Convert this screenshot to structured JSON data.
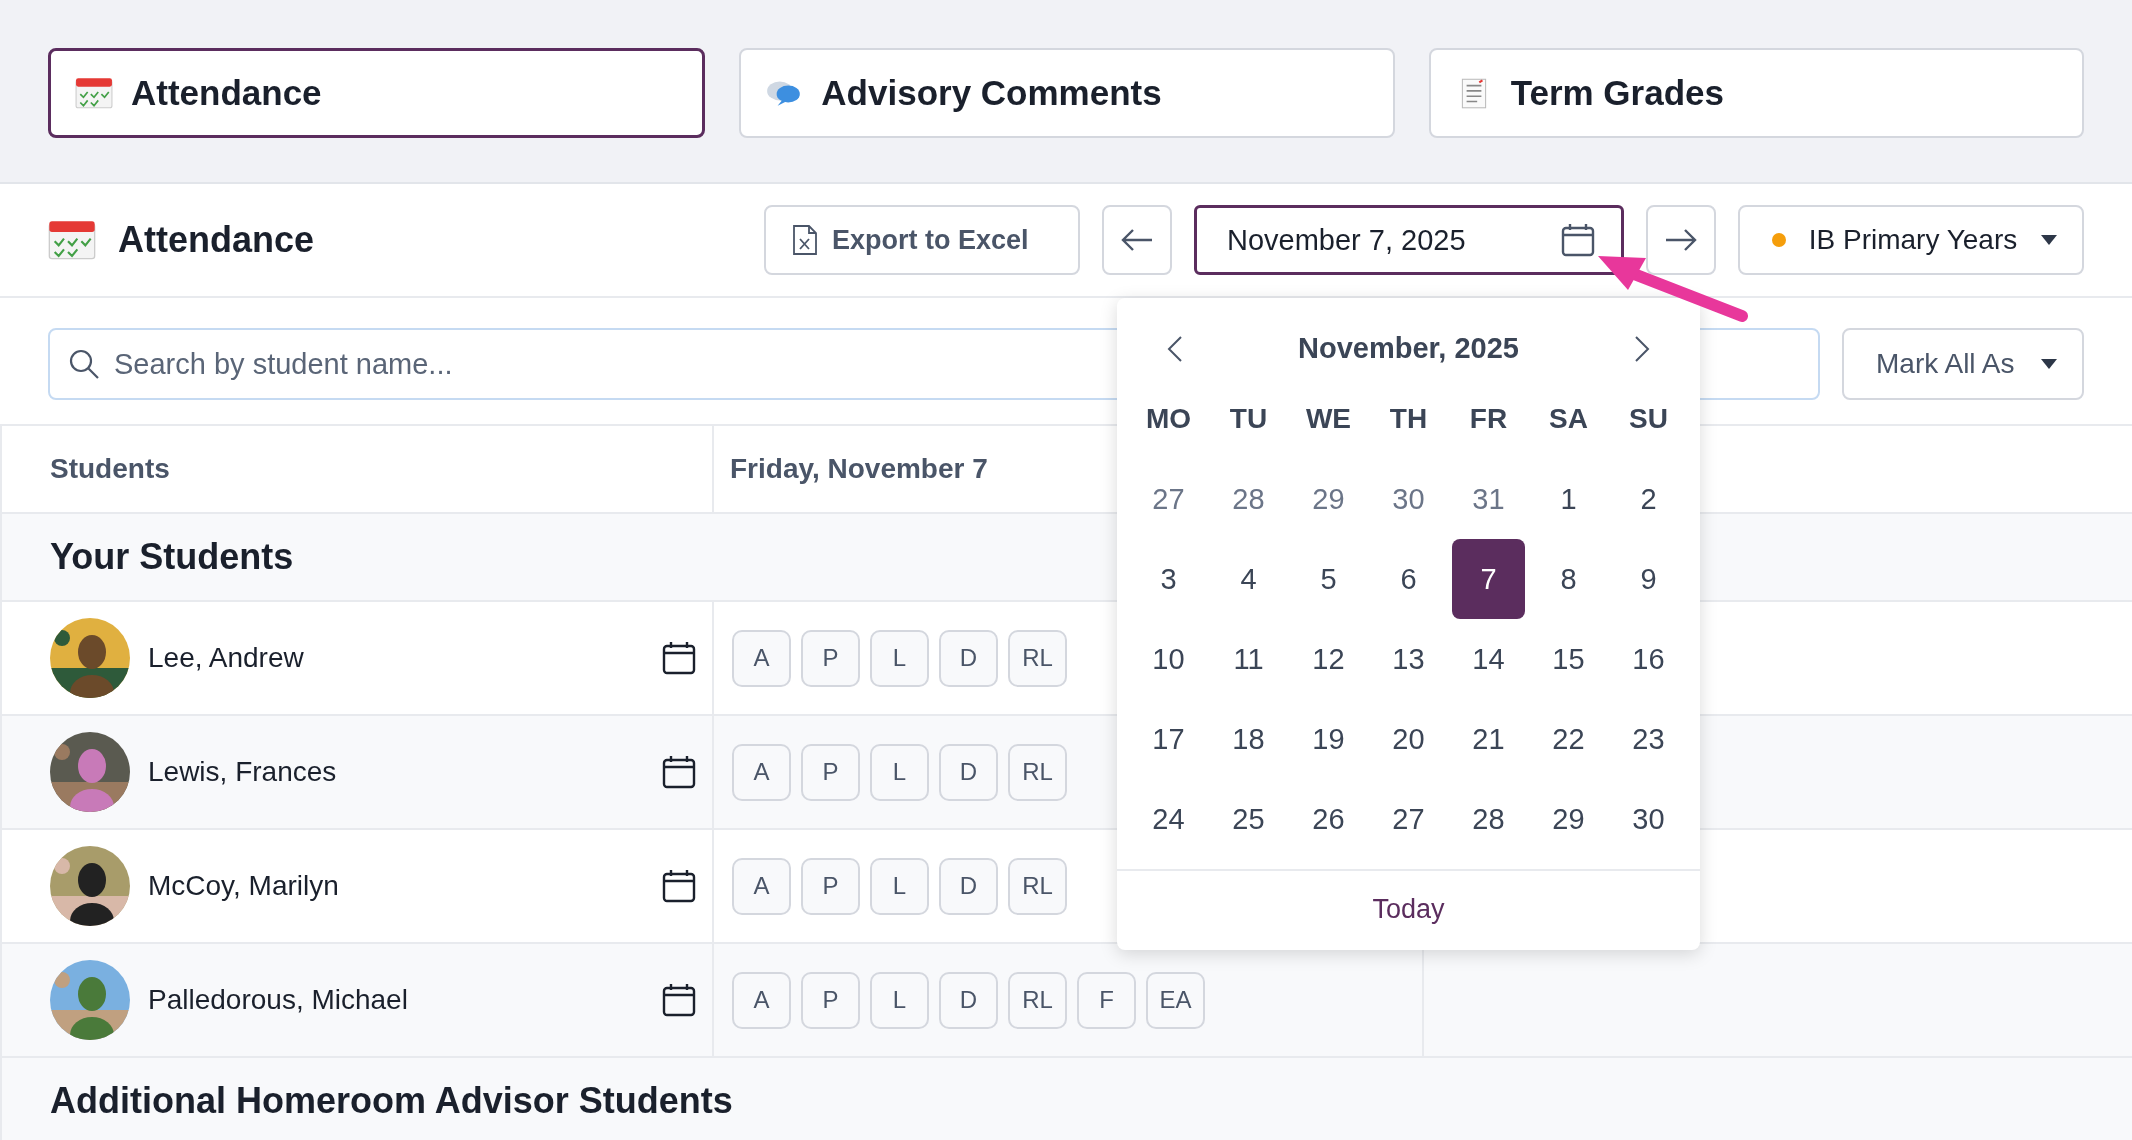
{
  "tabs": [
    {
      "label": "Attendance",
      "kind": "attendance",
      "selected": true
    },
    {
      "label": "Advisory Comments",
      "kind": "comments",
      "selected": false
    },
    {
      "label": "Term Grades",
      "kind": "grades",
      "selected": false
    }
  ],
  "header": {
    "title": "Attendance",
    "export_button": "Export to Excel",
    "date": "November 7, 2025",
    "program": "IB Primary Years"
  },
  "search": {
    "placeholder": "Search by student name..."
  },
  "mark_all": "Mark All As",
  "table": {
    "columns": [
      "Students",
      "Friday, November 7"
    ],
    "sections": [
      {
        "title": "Your Students",
        "rows": [
          {
            "name": "Lee, Andrew",
            "codes": [
              "A",
              "P",
              "L",
              "D",
              "RL"
            ]
          },
          {
            "name": "Lewis, Frances",
            "codes": [
              "A",
              "P",
              "L",
              "D",
              "RL"
            ]
          },
          {
            "name": "McCoy, Marilyn",
            "codes": [
              "A",
              "P",
              "L",
              "D",
              "RL"
            ]
          },
          {
            "name": "Palledorous, Michael",
            "codes": [
              "A",
              "P",
              "L",
              "D",
              "RL",
              "F",
              "EA"
            ]
          }
        ]
      },
      {
        "title": "Additional Homeroom Advisor Students"
      }
    ]
  },
  "date_picker": {
    "month": "November, 2025",
    "weekdays": [
      "MO",
      "TU",
      "WE",
      "TH",
      "FR",
      "SA",
      "SU"
    ],
    "weeks": [
      [
        {
          "day": "27",
          "outside": true,
          "selected": false
        },
        {
          "day": "28",
          "outside": true,
          "selected": false
        },
        {
          "day": "29",
          "outside": true,
          "selected": false
        },
        {
          "day": "30",
          "outside": true,
          "selected": false
        },
        {
          "day": "31",
          "outside": true,
          "selected": false
        },
        {
          "day": "1",
          "outside": false,
          "selected": false
        },
        {
          "day": "2",
          "outside": false,
          "selected": false
        }
      ],
      [
        {
          "day": "3",
          "outside": false,
          "selected": false
        },
        {
          "day": "4",
          "outside": false,
          "selected": false
        },
        {
          "day": "5",
          "outside": false,
          "selected": false
        },
        {
          "day": "6",
          "outside": false,
          "selected": false
        },
        {
          "day": "7",
          "outside": false,
          "selected": true
        },
        {
          "day": "8",
          "outside": false,
          "selected": false
        },
        {
          "day": "9",
          "outside": false,
          "selected": false
        }
      ],
      [
        {
          "day": "10",
          "outside": false,
          "selected": false
        },
        {
          "day": "11",
          "outside": false,
          "selected": false
        },
        {
          "day": "12",
          "outside": false,
          "selected": false
        },
        {
          "day": "13",
          "outside": false,
          "selected": false
        },
        {
          "day": "14",
          "outside": false,
          "selected": false
        },
        {
          "day": "15",
          "outside": false,
          "selected": false
        },
        {
          "day": "16",
          "outside": false,
          "selected": false
        }
      ],
      [
        {
          "day": "17",
          "outside": false,
          "selected": false
        },
        {
          "day": "18",
          "outside": false,
          "selected": false
        },
        {
          "day": "19",
          "outside": false,
          "selected": false
        },
        {
          "day": "20",
          "outside": false,
          "selected": false
        },
        {
          "day": "21",
          "outside": false,
          "selected": false
        },
        {
          "day": "22",
          "outside": false,
          "selected": false
        },
        {
          "day": "23",
          "outside": false,
          "selected": false
        }
      ],
      [
        {
          "day": "24",
          "outside": false,
          "selected": false
        },
        {
          "day": "25",
          "outside": false,
          "selected": false
        },
        {
          "day": "26",
          "outside": false,
          "selected": false
        },
        {
          "day": "27",
          "outside": false,
          "selected": false
        },
        {
          "day": "28",
          "outside": false,
          "selected": false
        },
        {
          "day": "29",
          "outside": false,
          "selected": false
        },
        {
          "day": "30",
          "outside": false,
          "selected": false
        }
      ]
    ],
    "today_button": "Today"
  }
}
